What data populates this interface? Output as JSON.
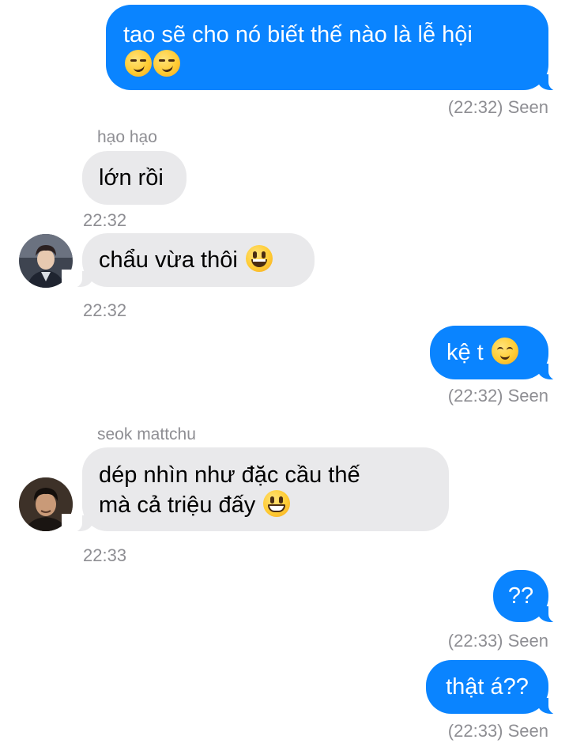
{
  "messages": [
    {
      "text": "tao sẽ cho nó biết thế nào là lễ hội",
      "emoji": [
        "smirking-face-icon",
        "smirking-face-icon"
      ],
      "status": "(22:32) Seen"
    },
    {
      "sender": "hạo hạo",
      "text1": "lớn rồi",
      "time1": "22:32",
      "text2": "chẩu vừa thôi",
      "emoji2": "smiley-face-icon",
      "time2": "22:32"
    },
    {
      "text": "kệ t",
      "emoji": "relieved-face-icon",
      "status": "(22:32) Seen"
    },
    {
      "sender": "seok mattchu",
      "line1": "dép nhìn như đặc cầu thế",
      "line2": "mà cả triệu đấy",
      "emoji": "grinning-face-icon",
      "time": "22:33"
    },
    {
      "text": "??",
      "status": "(22:33) Seen"
    },
    {
      "text": "thật á??",
      "status": "(22:33) Seen"
    }
  ],
  "colors": {
    "outgoing_bubble": "#0a84ff",
    "incoming_bubble": "#e9e9eb",
    "meta_text": "#8e8e93"
  }
}
